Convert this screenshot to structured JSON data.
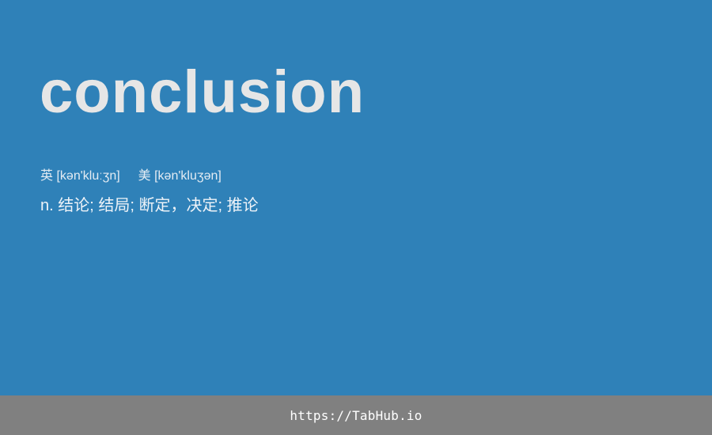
{
  "entry": {
    "word": "conclusion",
    "uk_label": "英",
    "uk_phonetic": "[kən'kluːʒn]",
    "us_label": "美",
    "us_phonetic": "[kən'kluʒən]",
    "definition": "n. 结论; 结局; 断定，决定; 推论"
  },
  "footer": {
    "url": "https://TabHub.io"
  },
  "colors": {
    "background": "#2f81b8",
    "word": "#e6e6e6",
    "footer_bar": "#808080",
    "footer_text": "#ffffff"
  }
}
